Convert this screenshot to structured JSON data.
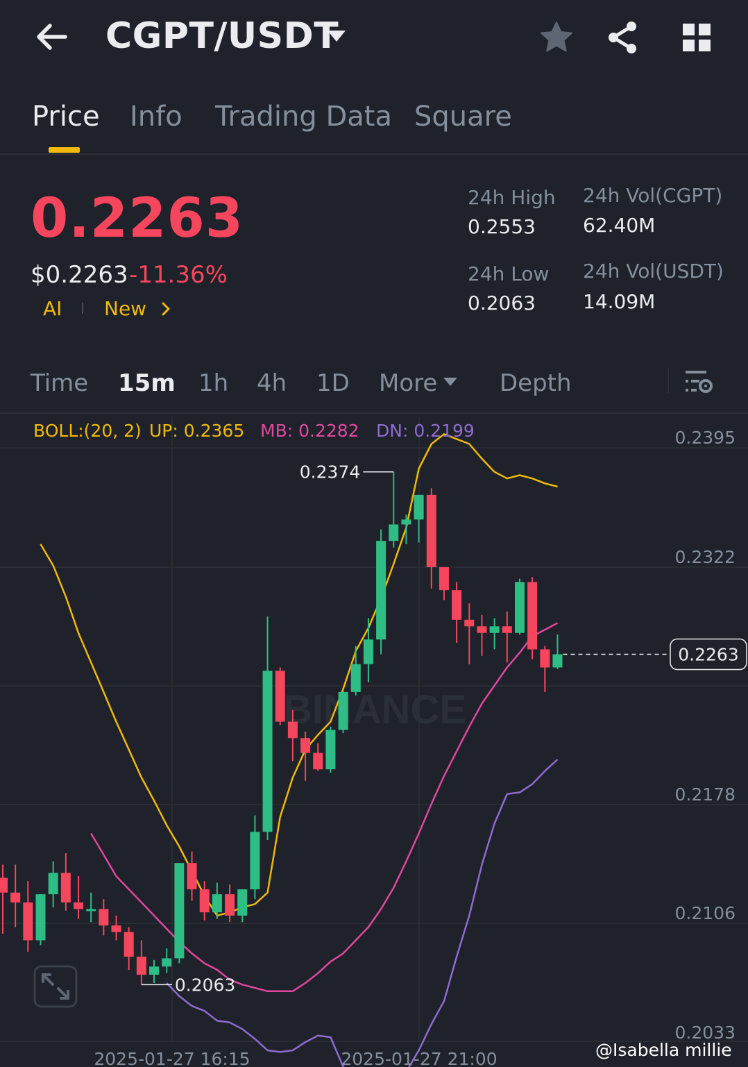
{
  "header": {
    "pair": "CGPT/USDT",
    "back_icon": "arrow-left-icon",
    "favorite_icon": "star-icon",
    "share_icon": "share-icon",
    "grid_icon": "grid-icon"
  },
  "tabs": [
    {
      "label": "Price",
      "active": true
    },
    {
      "label": "Info"
    },
    {
      "label": "Trading Data"
    },
    {
      "label": "Square"
    }
  ],
  "price": {
    "last": "0.2263",
    "usd": "$0.2263",
    "change": "-11.36%",
    "tags": [
      "AI",
      "New"
    ],
    "high_label": "24h High",
    "high": "0.2553",
    "low_label": "24h Low",
    "low": "0.2063",
    "vol_base_label": "24h Vol(CGPT)",
    "vol_base": "62.40M",
    "vol_quote_label": "24h Vol(USDT)",
    "vol_quote": "14.09M"
  },
  "intervals": {
    "items": [
      "Time",
      "15m",
      "1h",
      "4h",
      "1D",
      "More",
      "Depth"
    ],
    "active": "15m"
  },
  "boll": {
    "label": "BOLL:(20, 2)",
    "up": "UP: 0.2365",
    "mb": "MB: 0.2282",
    "dn": "DN: 0.2199"
  },
  "colors": {
    "up": "#2ebd85",
    "down": "#f6465d",
    "boll_up": "#f0b90b",
    "boll_mb": "#e0479e",
    "boll_dn": "#8e6bd1",
    "accent": "#f0b90b"
  },
  "chart_data": {
    "type": "candlestick",
    "y_ticks": [
      "0.2395",
      "0.2322",
      "0.2178",
      "0.2106",
      "0.2033"
    ],
    "y_range": [
      0.2033,
      0.2395
    ],
    "x_ticks": [
      "2025-01-27 16:15",
      "2025-01-27 21:00"
    ],
    "last_price_label": "0.2263",
    "high_marker": "0.2374",
    "low_marker": "0.2063",
    "watermark": "BINANCE",
    "candles": [
      {
        "o": 0.2127,
        "h": 0.2135,
        "l": 0.2093,
        "c": 0.2118
      },
      {
        "o": 0.2118,
        "h": 0.2135,
        "l": 0.2097,
        "c": 0.2112
      },
      {
        "o": 0.2112,
        "h": 0.2125,
        "l": 0.2082,
        "c": 0.2089
      },
      {
        "o": 0.2089,
        "h": 0.2117,
        "l": 0.2086,
        "c": 0.2117
      },
      {
        "o": 0.2117,
        "h": 0.2137,
        "l": 0.2109,
        "c": 0.213
      },
      {
        "o": 0.213,
        "h": 0.2142,
        "l": 0.2107,
        "c": 0.2112
      },
      {
        "o": 0.2112,
        "h": 0.2128,
        "l": 0.2102,
        "c": 0.2108
      },
      {
        "o": 0.2108,
        "h": 0.2118,
        "l": 0.21,
        "c": 0.2108
      },
      {
        "o": 0.2108,
        "h": 0.2114,
        "l": 0.2092,
        "c": 0.2098
      },
      {
        "o": 0.2098,
        "h": 0.2104,
        "l": 0.2089,
        "c": 0.2094
      },
      {
        "o": 0.2094,
        "h": 0.2097,
        "l": 0.2071,
        "c": 0.2079
      },
      {
        "o": 0.2079,
        "h": 0.2089,
        "l": 0.2062,
        "c": 0.2068
      },
      {
        "o": 0.2068,
        "h": 0.2077,
        "l": 0.2063,
        "c": 0.2073
      },
      {
        "o": 0.2073,
        "h": 0.2084,
        "l": 0.2069,
        "c": 0.2078
      },
      {
        "o": 0.2078,
        "h": 0.2136,
        "l": 0.2075,
        "c": 0.2136
      },
      {
        "o": 0.2136,
        "h": 0.2143,
        "l": 0.2113,
        "c": 0.212
      },
      {
        "o": 0.212,
        "h": 0.2125,
        "l": 0.2101,
        "c": 0.2106
      },
      {
        "o": 0.2106,
        "h": 0.2124,
        "l": 0.2102,
        "c": 0.2117
      },
      {
        "o": 0.2117,
        "h": 0.2123,
        "l": 0.21,
        "c": 0.2104
      },
      {
        "o": 0.2104,
        "h": 0.212,
        "l": 0.21,
        "c": 0.212
      },
      {
        "o": 0.212,
        "h": 0.2165,
        "l": 0.2114,
        "c": 0.2155
      },
      {
        "o": 0.2155,
        "h": 0.2286,
        "l": 0.215,
        "c": 0.2253
      },
      {
        "o": 0.2253,
        "h": 0.2255,
        "l": 0.222,
        "c": 0.2222
      },
      {
        "o": 0.2222,
        "h": 0.2229,
        "l": 0.2198,
        "c": 0.2212
      },
      {
        "o": 0.2212,
        "h": 0.2216,
        "l": 0.2186,
        "c": 0.2203
      },
      {
        "o": 0.2203,
        "h": 0.2209,
        "l": 0.2192,
        "c": 0.2193
      },
      {
        "o": 0.2193,
        "h": 0.2219,
        "l": 0.2191,
        "c": 0.2217
      },
      {
        "o": 0.2217,
        "h": 0.2241,
        "l": 0.2215,
        "c": 0.224
      },
      {
        "o": 0.224,
        "h": 0.2268,
        "l": 0.2238,
        "c": 0.2257
      },
      {
        "o": 0.2257,
        "h": 0.2285,
        "l": 0.2246,
        "c": 0.2272
      },
      {
        "o": 0.2272,
        "h": 0.2339,
        "l": 0.2263,
        "c": 0.2332
      },
      {
        "o": 0.2332,
        "h": 0.2374,
        "l": 0.2328,
        "c": 0.2342
      },
      {
        "o": 0.2342,
        "h": 0.2348,
        "l": 0.233,
        "c": 0.2345
      },
      {
        "o": 0.2345,
        "h": 0.2357,
        "l": 0.2331,
        "c": 0.236
      },
      {
        "o": 0.236,
        "h": 0.2364,
        "l": 0.2303,
        "c": 0.2316
      },
      {
        "o": 0.2316,
        "h": 0.2305,
        "l": 0.2296,
        "c": 0.2302
      },
      {
        "o": 0.2302,
        "h": 0.2307,
        "l": 0.227,
        "c": 0.2284
      },
      {
        "o": 0.2284,
        "h": 0.2294,
        "l": 0.2257,
        "c": 0.228
      },
      {
        "o": 0.228,
        "h": 0.2287,
        "l": 0.2262,
        "c": 0.2276
      },
      {
        "o": 0.2276,
        "h": 0.2285,
        "l": 0.2266,
        "c": 0.228
      },
      {
        "o": 0.228,
        "h": 0.2289,
        "l": 0.2258,
        "c": 0.2276
      },
      {
        "o": 0.2276,
        "h": 0.2309,
        "l": 0.2275,
        "c": 0.2307
      },
      {
        "o": 0.2307,
        "h": 0.231,
        "l": 0.226,
        "c": 0.2266
      },
      {
        "o": 0.2266,
        "h": 0.2268,
        "l": 0.224,
        "c": 0.2255
      },
      {
        "o": 0.2255,
        "h": 0.2275,
        "l": 0.2254,
        "c": 0.2263
      }
    ],
    "boll_up_series": [
      0.233,
      0.2317,
      0.2298,
      0.2276,
      0.2258,
      0.224,
      0.2222,
      0.2205,
      0.2188,
      0.2174,
      0.2159,
      0.2146,
      0.2131,
      0.2116,
      0.2104,
      0.2106,
      0.2109,
      0.2111,
      0.2118,
      0.2164,
      0.2188,
      0.2205,
      0.2214,
      0.2222,
      0.2242,
      0.2265,
      0.2279,
      0.2297,
      0.2318,
      0.234,
      0.2376,
      0.2391,
      0.2397,
      0.2394,
      0.2391,
      0.2382,
      0.2374,
      0.237,
      0.2372,
      0.237,
      0.2367,
      0.2365
    ],
    "boll_mb_series": [
      0.2154,
      0.2141,
      0.2128,
      0.212,
      0.2112,
      0.2104,
      0.2096,
      0.2088,
      0.2081,
      0.2075,
      0.2071,
      0.2065,
      0.2062,
      0.206,
      0.2058,
      0.2058,
      0.2058,
      0.2063,
      0.2069,
      0.2076,
      0.2081,
      0.2089,
      0.2097,
      0.2108,
      0.2121,
      0.2137,
      0.2154,
      0.2172,
      0.2189,
      0.2204,
      0.2219,
      0.2233,
      0.2244,
      0.2255,
      0.2264,
      0.2274,
      0.2278,
      0.2282
    ],
    "boll_dn_series": [
      0.2063,
      0.2055,
      0.2049,
      0.2046,
      0.204,
      0.2039,
      0.2035,
      0.2029,
      0.2022,
      0.2021,
      0.2022,
      0.2027,
      0.2031,
      0.203,
      0.2012,
      0.2007,
      0.2003,
      0.2002,
      0.2001,
      0.2009,
      0.2022,
      0.2038,
      0.2052,
      0.2079,
      0.2104,
      0.2135,
      0.216,
      0.2178,
      0.2179,
      0.2184,
      0.2192,
      0.2199
    ]
  },
  "footer": {
    "watermark": "@Isabella millie"
  }
}
